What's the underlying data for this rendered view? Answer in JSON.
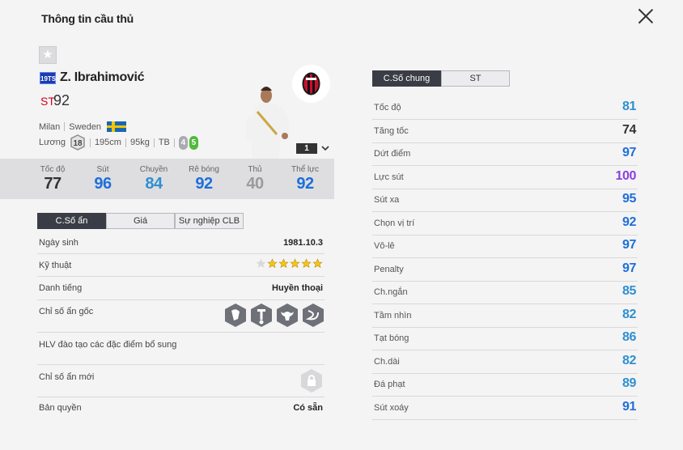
{
  "dialog": {
    "title": "Thông tin cầu thủ"
  },
  "player": {
    "season": "19TS",
    "name": "Z. Ibrahimović",
    "position": "ST",
    "overall": "92",
    "club": "Milan",
    "nation": "Sweden",
    "wage_label": "Lương",
    "wage": "18",
    "height": "195cm",
    "weight": "95kg",
    "build": "TB",
    "weak_foot": "4",
    "strong_foot": "5",
    "rank": "1"
  },
  "summary_stats": [
    {
      "label": "Tốc độ",
      "value": "77",
      "color": "#333333"
    },
    {
      "label": "Sút",
      "value": "96",
      "color": "#1e6fd9"
    },
    {
      "label": "Chuyền",
      "value": "84",
      "color": "#2f8fd1"
    },
    {
      "label": "Rê bóng",
      "value": "92",
      "color": "#1e6fd9"
    },
    {
      "label": "Thủ",
      "value": "40",
      "color": "#9a9a9a"
    },
    {
      "label": "Thể lực",
      "value": "92",
      "color": "#1e6fd9"
    }
  ],
  "left_tabs": [
    "C.Số ẩn",
    "Giá",
    "Sự nghiệp CLB"
  ],
  "details": {
    "birth_label": "Ngày sinh",
    "birth_value": "1981.10.3",
    "skill_label": "Kỹ thuật",
    "skill_stars": 5,
    "skill_max": 6,
    "fame_label": "Danh tiếng",
    "fame_value": "Huyền thoại",
    "traits_label": "Chỉ số ẩn gốc",
    "traits": [
      "tiki-taka-icon",
      "power-header-icon",
      "bull-icon",
      "flair-icon"
    ],
    "coach_label": "HLV đào tạo các đặc điểm bổ sung",
    "new_traits_label": "Chỉ số ẩn mới",
    "license_label": "Bản quyền",
    "license_value": "Có sẵn"
  },
  "right_tabs": [
    "C.Số chung",
    "ST"
  ],
  "attributes": [
    {
      "label": "Tốc độ",
      "value": "81",
      "color": "#2f8fd1"
    },
    {
      "label": "Tăng tốc",
      "value": "74",
      "color": "#333333"
    },
    {
      "label": "Dứt điểm",
      "value": "97",
      "color": "#1e6fd9"
    },
    {
      "label": "Lực sút",
      "value": "100",
      "color": "#8a3fe0"
    },
    {
      "label": "Sút xa",
      "value": "95",
      "color": "#1e6fd9"
    },
    {
      "label": "Chọn vị trí",
      "value": "92",
      "color": "#1e6fd9"
    },
    {
      "label": "Vô-lê",
      "value": "97",
      "color": "#1e6fd9"
    },
    {
      "label": "Penalty",
      "value": "97",
      "color": "#1e6fd9"
    },
    {
      "label": "Ch.ngắn",
      "value": "85",
      "color": "#2f8fd1"
    },
    {
      "label": "Tầm nhìn",
      "value": "82",
      "color": "#2f8fd1"
    },
    {
      "label": "Tạt bóng",
      "value": "86",
      "color": "#2f8fd1"
    },
    {
      "label": "Ch.dài",
      "value": "82",
      "color": "#2f8fd1"
    },
    {
      "label": "Đá phạt",
      "value": "89",
      "color": "#2f8fd1"
    },
    {
      "label": "Sút xoáy",
      "value": "91",
      "color": "#1e6fd9"
    }
  ]
}
